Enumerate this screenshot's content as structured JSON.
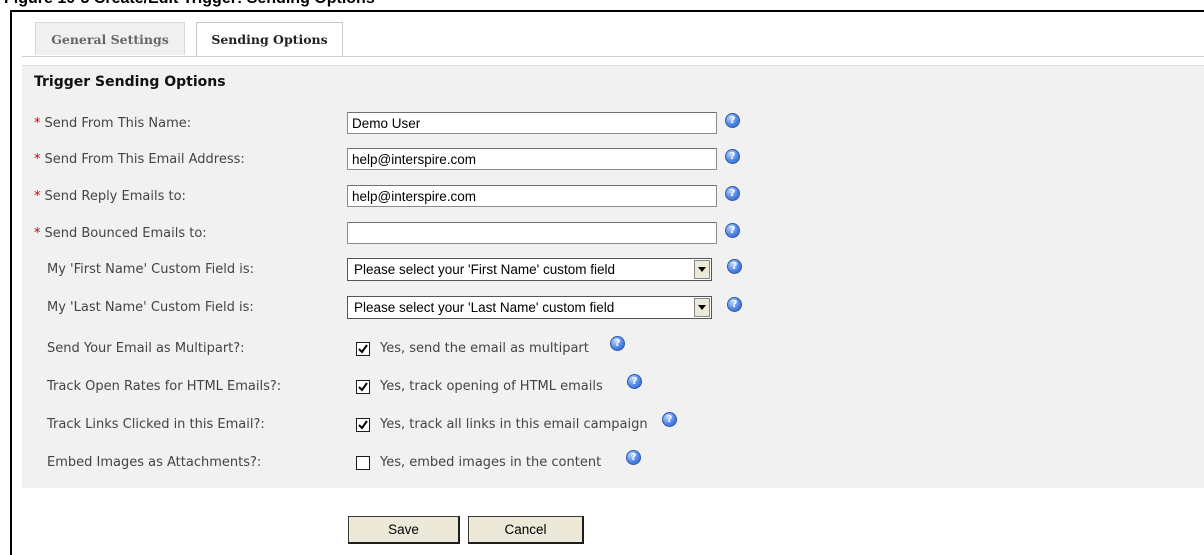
{
  "caption": "Figure 10-3 Create/Edit Trigger: Sending Options",
  "tabs": [
    {
      "label": "General Settings",
      "active": false
    },
    {
      "label": "Sending Options",
      "active": true
    }
  ],
  "section_title": "Trigger Sending Options",
  "fields": {
    "send_from_name": {
      "label": "Send From This Name:",
      "value": "Demo User",
      "required": true
    },
    "send_from_email": {
      "label": "Send From This Email Address:",
      "value": "help@interspire.com",
      "required": true
    },
    "reply_to": {
      "label": "Send Reply Emails to:",
      "value": "help@interspire.com",
      "required": true
    },
    "bounce_to": {
      "label": "Send Bounced Emails to:",
      "value": "",
      "required": true
    },
    "first_name_field": {
      "label": "My 'First Name' Custom Field is:",
      "value": "Please select your 'First Name' custom field"
    },
    "last_name_field": {
      "label": "My 'Last Name' Custom Field is:",
      "value": "Please select your 'Last Name' custom field"
    }
  },
  "options": {
    "multipart": {
      "label": "Send Your Email as Multipart?:",
      "text": "Yes, send the email as multipart",
      "checked": true
    },
    "track_open": {
      "label": "Track Open Rates for HTML Emails?:",
      "text": "Yes, track opening of HTML emails",
      "checked": true
    },
    "track_links": {
      "label": "Track Links Clicked in this Email?:",
      "text": "Yes, track all links in this email campaign",
      "checked": true
    },
    "embed_images": {
      "label": "Embed Images as Attachments?:",
      "text": "Yes, embed images in the content",
      "checked": false
    }
  },
  "required_marker": "*",
  "help_glyph": "?",
  "buttons": {
    "save": "Save",
    "cancel": "Cancel"
  },
  "colors": {
    "panel_bg": "#f1f1f1",
    "required": "#cc0000",
    "help": "#4f86e8"
  }
}
